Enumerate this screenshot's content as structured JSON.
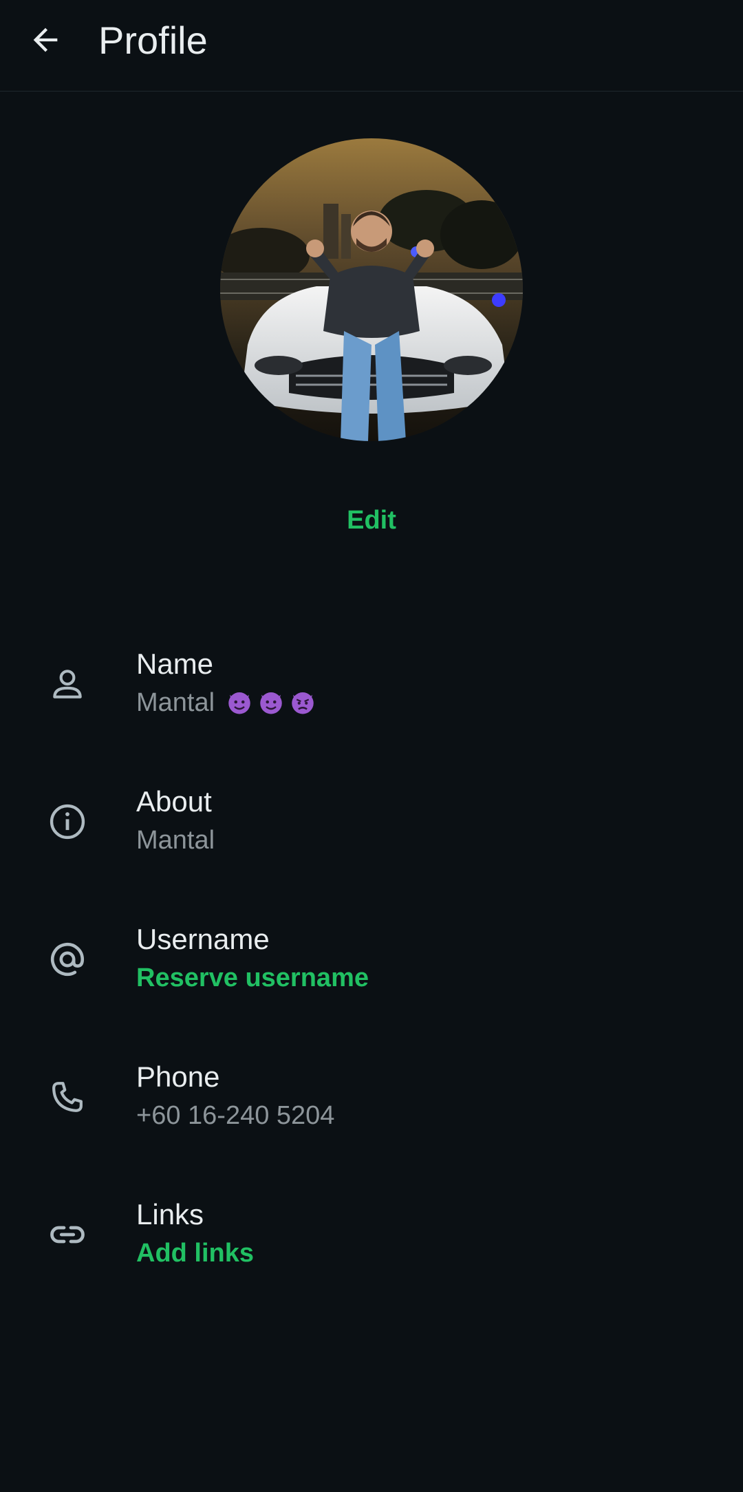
{
  "header": {
    "title": "Profile",
    "back_icon": "arrow-left-icon"
  },
  "profile_photo": {
    "edit_label": "Edit"
  },
  "fields": {
    "name": {
      "label": "Name",
      "value": "Mantal",
      "emojis": [
        "smiling-devil-icon",
        "smiling-devil-icon",
        "angry-devil-icon"
      ],
      "icon": "person-icon"
    },
    "about": {
      "label": "About",
      "value": "Mantal",
      "icon": "info-icon"
    },
    "username": {
      "label": "Username",
      "value": "Reserve username",
      "icon": "at-sign-icon"
    },
    "phone": {
      "label": "Phone",
      "value": "+60 16-240 5204",
      "icon": "phone-icon"
    },
    "links": {
      "label": "Links",
      "value": "Add links",
      "icon": "link-icon"
    }
  },
  "colors": {
    "background": "#0b1014",
    "accent": "#21c063",
    "primary_text": "#e9edef",
    "secondary_text": "#8d959a",
    "icon": "#aebac1"
  }
}
